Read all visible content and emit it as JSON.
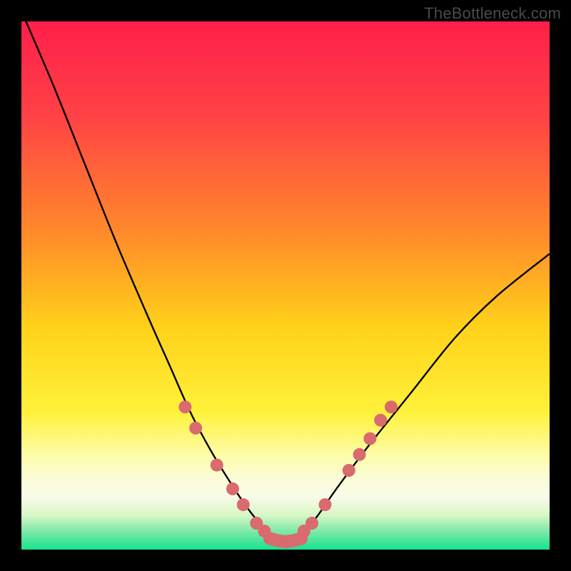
{
  "watermark": "TheBottleneck.com",
  "chart_data": {
    "type": "line",
    "title": "",
    "xlabel": "",
    "ylabel": "",
    "xlim": [
      0,
      100
    ],
    "ylim": [
      0,
      100
    ],
    "series": [
      {
        "name": "curve",
        "x": [
          0,
          6,
          12,
          18,
          24,
          28,
          32,
          36,
          40,
          42,
          44,
          46,
          48,
          50,
          52,
          54,
          56,
          60,
          66,
          74,
          82,
          90,
          100
        ],
        "y": [
          102,
          88,
          73,
          58,
          44,
          35,
          26,
          18.5,
          12,
          9,
          6.3,
          4,
          2.3,
          1.5,
          2.3,
          4,
          6.3,
          12,
          20,
          30,
          40,
          48,
          56
        ]
      }
    ],
    "markers": {
      "left": [
        [
          31,
          27
        ],
        [
          33,
          23
        ],
        [
          37,
          16
        ],
        [
          40,
          11.5
        ],
        [
          42,
          8.5
        ],
        [
          44.5,
          5
        ],
        [
          46,
          3.5
        ]
      ],
      "right": [
        [
          53.5,
          3.5
        ],
        [
          55,
          5
        ],
        [
          57.5,
          8.5
        ],
        [
          62,
          15
        ],
        [
          64,
          18
        ],
        [
          66,
          21
        ],
        [
          68,
          24.5
        ],
        [
          70,
          27
        ]
      ],
      "bottom": [
        [
          47,
          2.1
        ],
        [
          48.5,
          1.7
        ],
        [
          50,
          1.5
        ],
        [
          51.5,
          1.7
        ],
        [
          53,
          2.1
        ]
      ]
    },
    "gradient_stops": [
      {
        "offset": 0,
        "color": "#ff1f4b"
      },
      {
        "offset": 0.18,
        "color": "#ff4245"
      },
      {
        "offset": 0.4,
        "color": "#ff8a2a"
      },
      {
        "offset": 0.58,
        "color": "#ffd21a"
      },
      {
        "offset": 0.74,
        "color": "#fff13a"
      },
      {
        "offset": 0.82,
        "color": "#fcfda6"
      },
      {
        "offset": 0.865,
        "color": "#fbfbd8"
      },
      {
        "offset": 0.9,
        "color": "#f8fce8"
      },
      {
        "offset": 0.935,
        "color": "#d8f6c6"
      },
      {
        "offset": 0.965,
        "color": "#7de9a8"
      },
      {
        "offset": 1.0,
        "color": "#17e38f"
      }
    ],
    "marker_color": "#d96a6e",
    "curve_color": "#000000"
  }
}
